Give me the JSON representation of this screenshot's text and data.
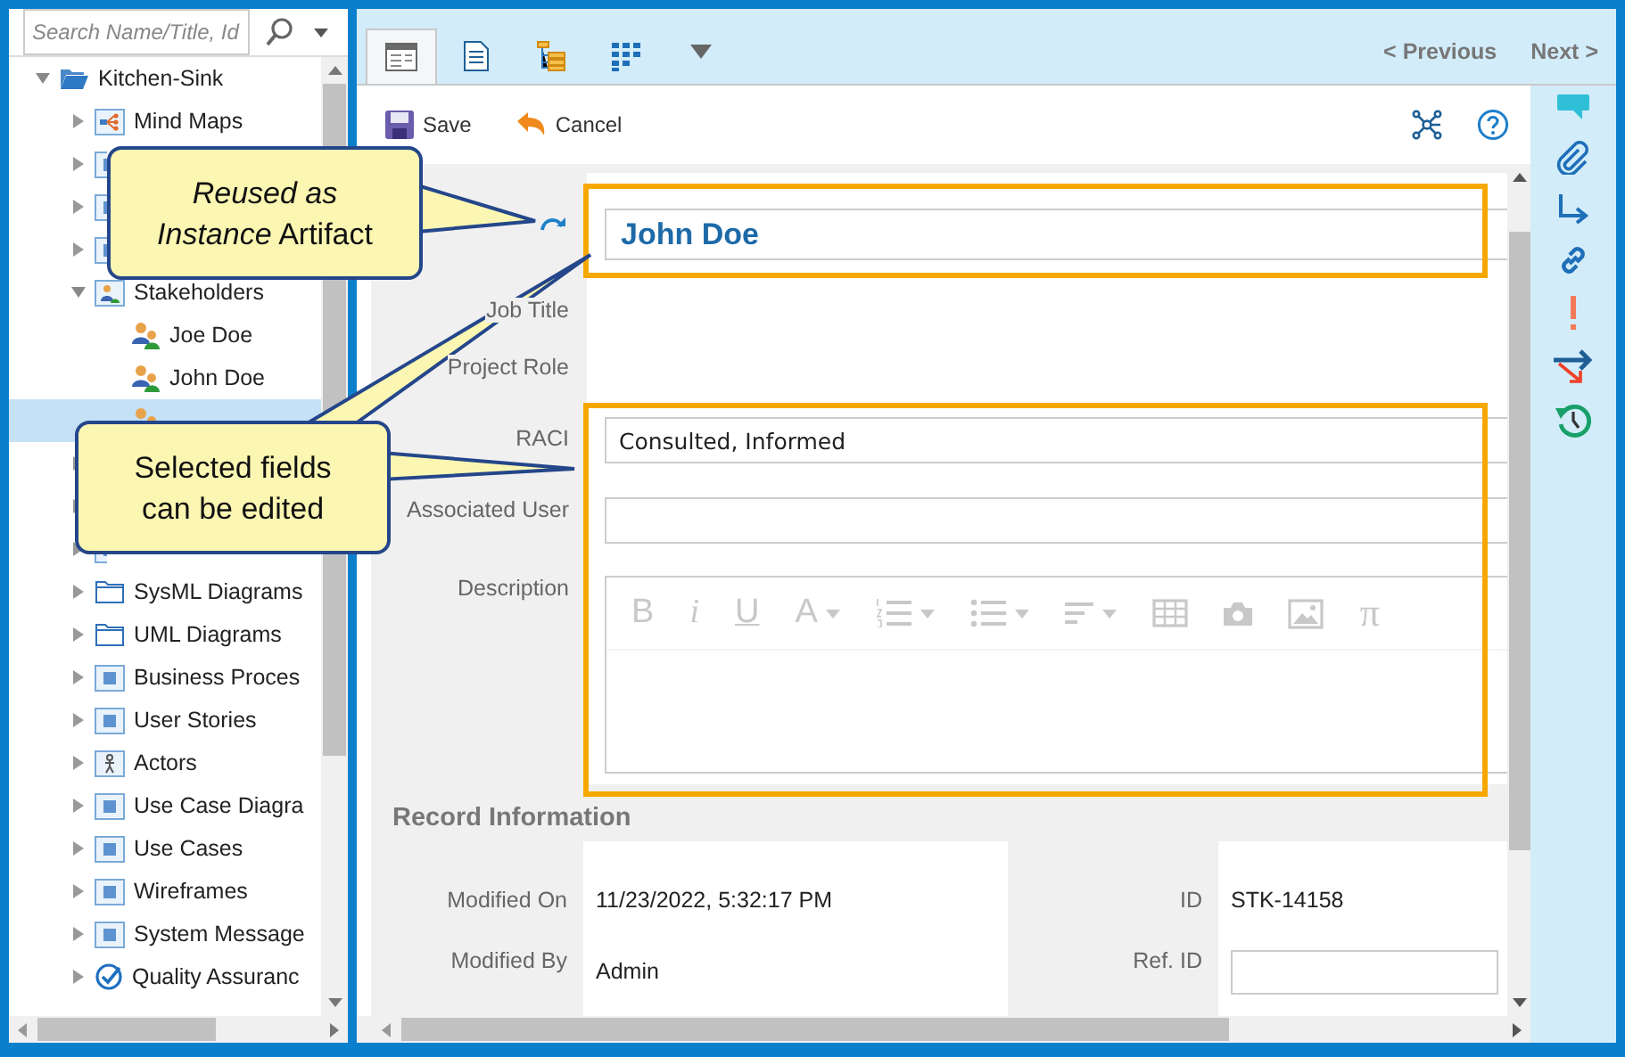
{
  "sidebar": {
    "search": {
      "placeholder": "Search Name/Title, Id"
    },
    "tree": [
      {
        "label": "Kitchen-Sink",
        "kind": "root",
        "expanded": true,
        "selected": false,
        "children": [
          {
            "label": "Mind Maps",
            "kind": "mindmap",
            "expanded": false,
            "selected": false
          },
          {
            "kind": "tile",
            "expanded": false,
            "selected": false
          },
          {
            "kind": "tile",
            "expanded": false,
            "selected": false
          },
          {
            "kind": "tile",
            "expanded": false,
            "selected": false
          },
          {
            "label": "Stakeholders",
            "kind": "group",
            "expanded": true,
            "selected": false,
            "children": [
              {
                "label": "Joe Doe",
                "kind": "person",
                "selected": false
              },
              {
                "label": "John Doe",
                "kind": "person",
                "selected": false
              },
              {
                "kind": "person",
                "selected": true
              }
            ]
          },
          {
            "kind": "tile",
            "expanded": false,
            "selected": false
          },
          {
            "kind": "tile",
            "expanded": false,
            "selected": false
          },
          {
            "kind": "tile",
            "expanded": false,
            "selected": false
          },
          {
            "label": "SysML Diagrams",
            "kind": "folder",
            "expanded": false,
            "selected": false
          },
          {
            "label": "UML Diagrams",
            "kind": "folder",
            "expanded": false,
            "selected": false
          },
          {
            "label": "Business Proces",
            "kind": "tile",
            "expanded": false,
            "selected": false
          },
          {
            "label": "User Stories",
            "kind": "tile",
            "expanded": false,
            "selected": false
          },
          {
            "label": "Actors",
            "kind": "actor",
            "expanded": false,
            "selected": false
          },
          {
            "label": "Use Case Diagra",
            "kind": "tile",
            "expanded": false,
            "selected": false
          },
          {
            "label": "Use Cases",
            "kind": "tile",
            "expanded": false,
            "selected": false
          },
          {
            "label": "Wireframes",
            "kind": "tile",
            "expanded": false,
            "selected": false
          },
          {
            "label": "System Message",
            "kind": "tile",
            "expanded": false,
            "selected": false
          },
          {
            "label": "Quality Assuranc",
            "kind": "quality",
            "expanded": false,
            "selected": false
          }
        ]
      }
    ]
  },
  "tabs": [
    {
      "kind": "form",
      "selected": true
    },
    {
      "kind": "document",
      "selected": false
    },
    {
      "kind": "tree",
      "selected": false
    },
    {
      "kind": "grid",
      "selected": false
    }
  ],
  "nav": {
    "previous": "< Previous",
    "next": "Next >"
  },
  "toolbar": [
    {
      "kind": "save",
      "label": "Save"
    },
    {
      "kind": "cancel",
      "label": "Cancel"
    }
  ],
  "form": {
    "name": "John Doe",
    "reused": true,
    "fields": [
      {
        "kind": "plain",
        "label": "Job Title"
      },
      {
        "kind": "plain",
        "label": "Project Role"
      },
      {
        "kind": "input",
        "label": "RACI",
        "value": "Consulted, Informed"
      },
      {
        "kind": "input",
        "label": "Associated User"
      },
      {
        "kind": "editor",
        "label": "Description"
      }
    ]
  },
  "editor": {
    "disabled": true,
    "tools": [
      {
        "kind": "char",
        "label": "B"
      },
      {
        "kind": "char",
        "label": "i"
      },
      {
        "kind": "char",
        "label": "U"
      },
      {
        "kind": "char",
        "label": "A",
        "dropdown": true
      },
      {
        "kind": "numbers",
        "dropdown": true
      },
      {
        "kind": "bullets",
        "dropdown": true
      },
      {
        "kind": "align",
        "dropdown": true
      },
      {
        "kind": "table"
      },
      {
        "kind": "camera"
      },
      {
        "kind": "image"
      },
      {
        "kind": "char",
        "label": "π"
      }
    ]
  },
  "record": {
    "title": "Record Information",
    "rows": [
      [
        {
          "kind": "text",
          "label": "Modified On",
          "value": "11/23/2022, 5:32:17 PM"
        },
        {
          "kind": "text",
          "label": "ID",
          "value": "STK-14158"
        }
      ],
      [
        {
          "kind": "text",
          "label": "Modified By",
          "value": "Admin"
        },
        {
          "kind": "input",
          "label": "Ref. ID"
        }
      ]
    ]
  },
  "callouts": [
    {
      "lines": [
        "*Reused as*",
        "*Instance* Artifact"
      ]
    },
    {
      "lines": [
        "Selected fields",
        "can be edited"
      ]
    }
  ]
}
